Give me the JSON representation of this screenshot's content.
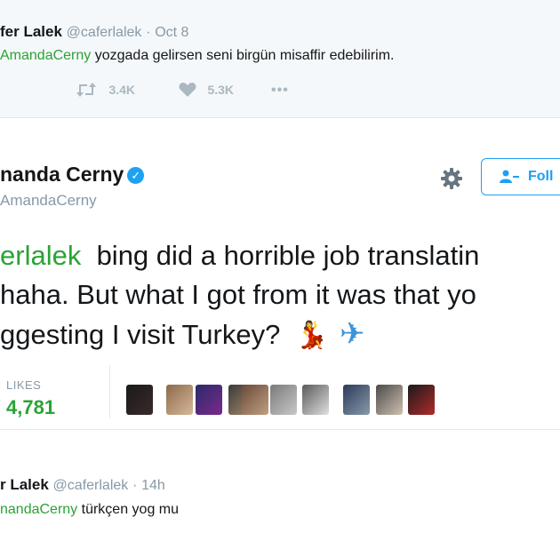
{
  "top_reply": {
    "name": "fer Lalek",
    "handle": "@caferlalek",
    "separator": "·",
    "date": "Oct 8",
    "mention": "AmandaCerny",
    "text": "yozgada gelirsen seni birgün misaffir edebilirim.",
    "retweets": "3.4K",
    "likes": "5.3K",
    "more": "•••"
  },
  "main_tweet": {
    "name": "nanda Cerny",
    "handle": "AmandaCerny",
    "follow_label": "Foll",
    "line1_mention": "erlalek",
    "line1_rest": "bing did a horrible job translatin",
    "line2": "haha. But what I got from it was that yo",
    "line3": "ggesting I visit Turkey?",
    "emoji": [
      "💃",
      "✈"
    ],
    "likes_label": "LIKES",
    "likes_count": "4,781"
  },
  "bottom_reply": {
    "name": "r Lalek",
    "handle": "@caferlalek",
    "separator": "·",
    "time": "14h",
    "mention": "nandaCerny",
    "text": "türkçen yog mu"
  },
  "colors": {
    "mention_green": "#2aa335",
    "twitter_blue": "#1da1f2",
    "like_green": "#2aa335",
    "muted": "#8899a6",
    "icon_gray": "#aab8c2",
    "top_bg": "#f5f8fa"
  }
}
